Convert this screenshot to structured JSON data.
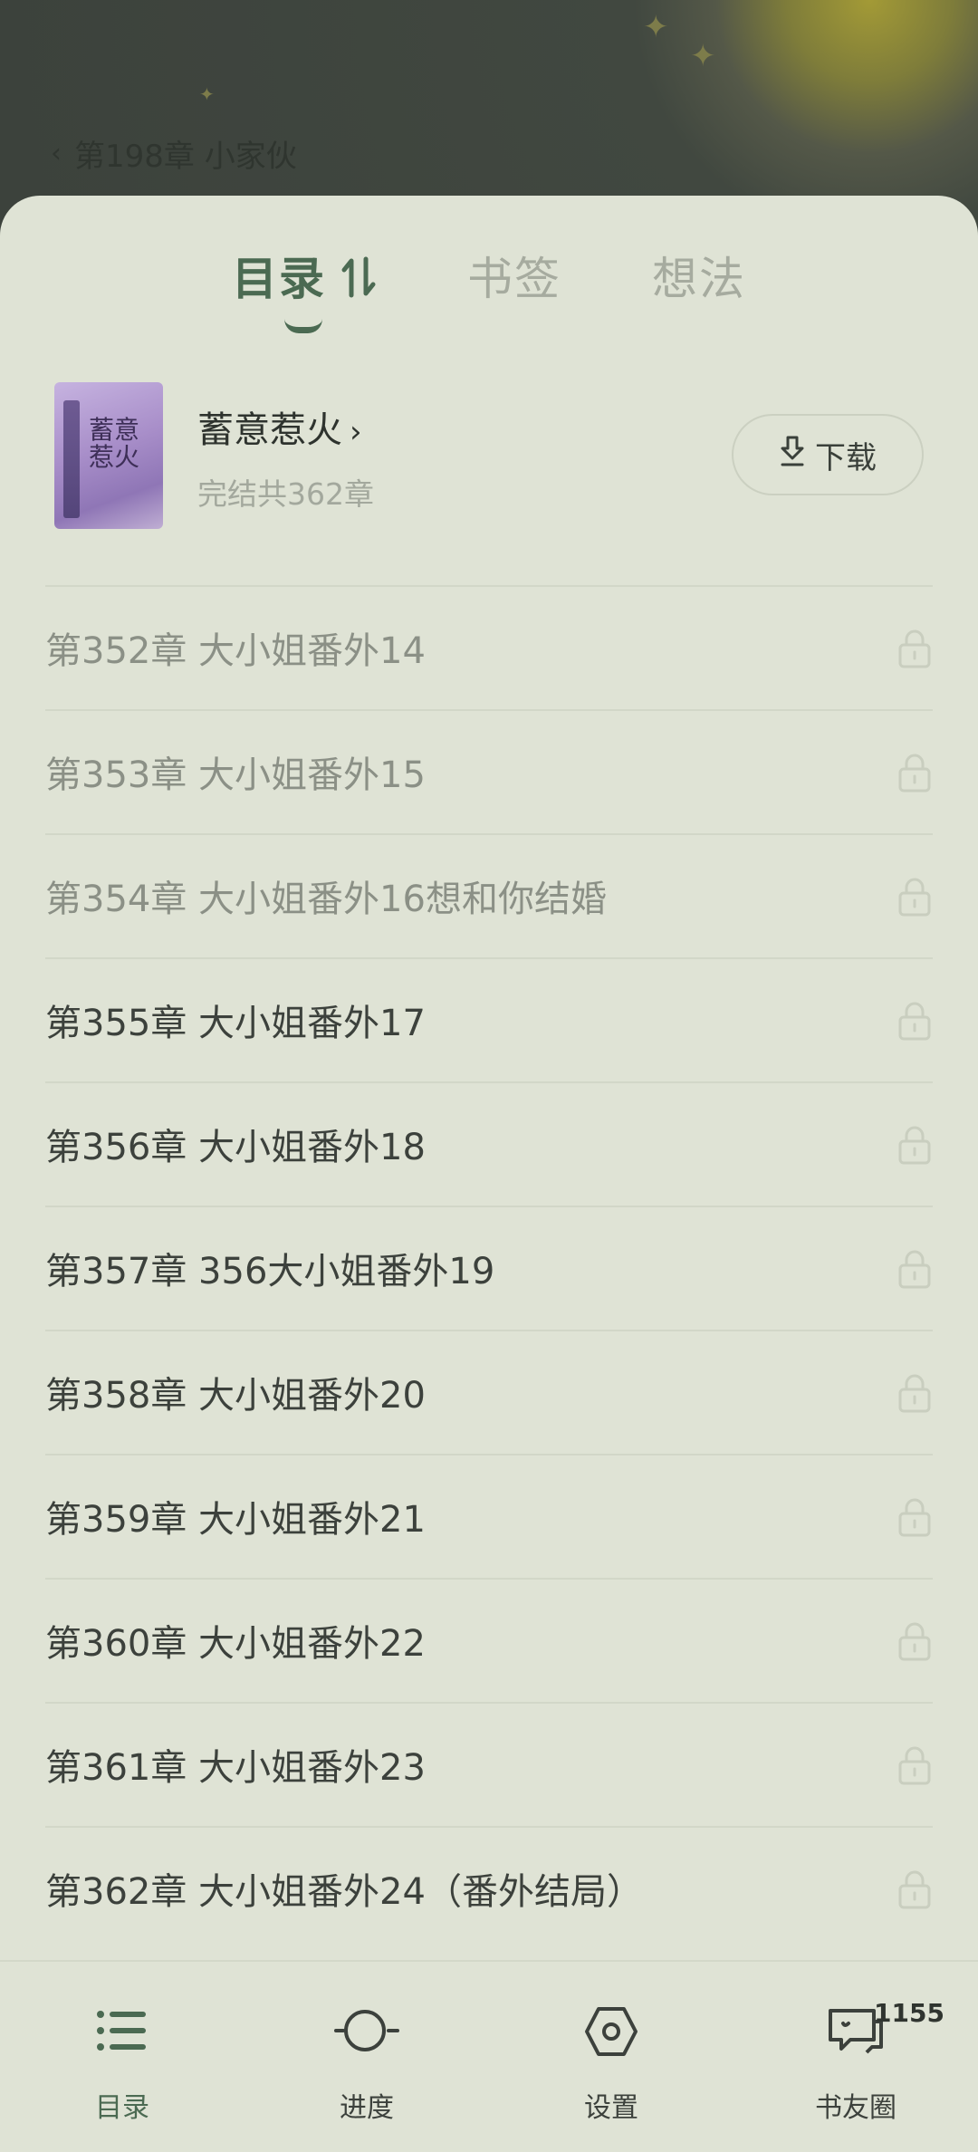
{
  "reader": {
    "chapter_title": "第198章 小家伙"
  },
  "tabs": [
    {
      "label": "目录",
      "active": true
    },
    {
      "label": "书签",
      "active": false
    },
    {
      "label": "想法",
      "active": false
    }
  ],
  "book": {
    "cover_text": "蓄意惹火",
    "title": "蓄意惹火",
    "title_arrow": "›",
    "subtitle": "完结共362章",
    "download_label": "下载"
  },
  "chapters": [
    {
      "label": "第352章 大小姐番外14",
      "read": true
    },
    {
      "label": "第353章 大小姐番外15",
      "read": true
    },
    {
      "label": "第354章 大小姐番外16想和你结婚",
      "read": true
    },
    {
      "label": "第355章 大小姐番外17",
      "read": false
    },
    {
      "label": "第356章 大小姐番外18",
      "read": false
    },
    {
      "label": "第357章 356大小姐番外19",
      "read": false
    },
    {
      "label": "第358章 大小姐番外20",
      "read": false
    },
    {
      "label": "第359章 大小姐番外21",
      "read": false
    },
    {
      "label": "第360章 大小姐番外22",
      "read": false
    },
    {
      "label": "第361章 大小姐番外23",
      "read": false
    },
    {
      "label": "第362章 大小姐番外24（番外结局）",
      "read": false
    }
  ],
  "bottom_nav": [
    {
      "label": "目录",
      "icon": "list-icon",
      "active": true
    },
    {
      "label": "进度",
      "icon": "progress-icon",
      "active": false
    },
    {
      "label": "设置",
      "icon": "settings-icon",
      "active": false
    },
    {
      "label": "书友圈",
      "icon": "chat-icon",
      "active": false,
      "badge": "1155"
    }
  ],
  "colors": {
    "accent": "#4b6a52",
    "sheet_bg": "#dfe3d5"
  }
}
